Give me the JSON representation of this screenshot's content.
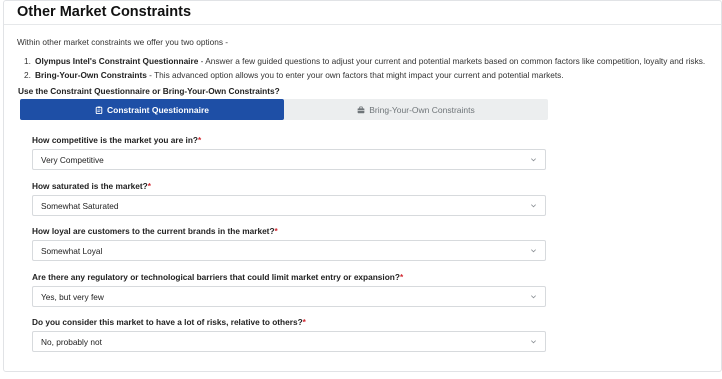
{
  "header": {
    "title": "Other Market Constraints"
  },
  "intro": "Within other market constraints we offer you two options -",
  "options": [
    {
      "num": "1.",
      "name": "Olympus Intel's Constraint Questionnaire",
      "desc": " - Answer a few guided questions to adjust your current and potential markets based on common factors like competition, loyalty and risks."
    },
    {
      "num": "2.",
      "name": "Bring-Your-Own Constraints",
      "desc": " - This advanced option allows you to enter your own factors that might impact your current and potential markets."
    }
  ],
  "choice_question": "Use the Constraint Questionnaire or Bring-Your-Own Constraints?",
  "tabs": {
    "questionnaire": {
      "label": "Constraint Questionnaire",
      "icon": "clipboard-icon",
      "active": true
    },
    "byo": {
      "label": "Bring-Your-Own Constraints",
      "icon": "briefcase-icon",
      "active": false
    }
  },
  "fields": [
    {
      "label": "How competitive is the market you are in?",
      "required_mark": "*",
      "value": "Very Competitive"
    },
    {
      "label": "How saturated is the market?",
      "required_mark": "*",
      "value": "Somewhat Saturated"
    },
    {
      "label": "How loyal are customers to the current brands in the market?",
      "required_mark": "*",
      "value": "Somewhat Loyal"
    },
    {
      "label": "Are there any regulatory or technological barriers that could limit market entry or expansion?",
      "required_mark": "*",
      "value": "Yes, but very few"
    },
    {
      "label": "Do you consider this market to have a lot of risks, relative to others?",
      "required_mark": "*",
      "value": "No, probably not"
    }
  ],
  "colors": {
    "accent": "#1e4fa6",
    "required": "#d22a33",
    "tab_bg": "#eceeef"
  }
}
